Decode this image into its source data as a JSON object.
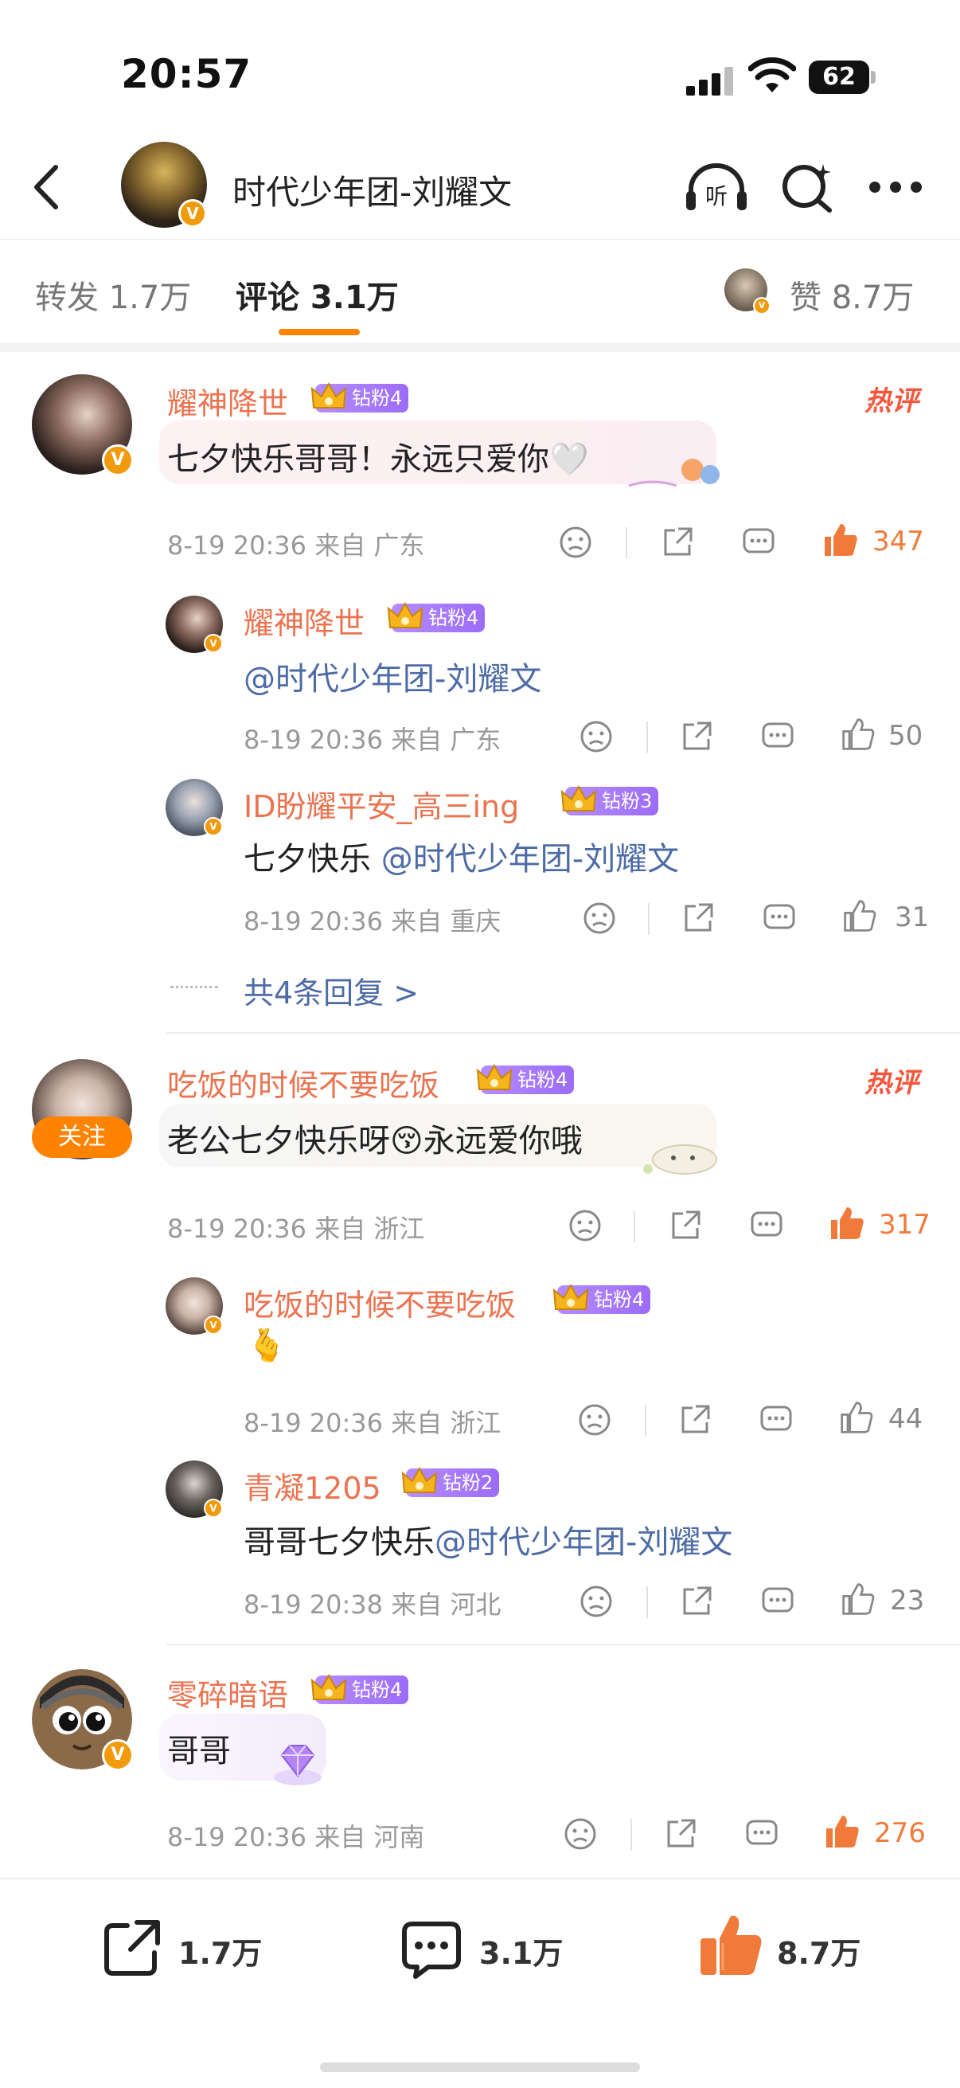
{
  "status_bar": {
    "time": "20:57",
    "battery": "62"
  },
  "header": {
    "title": "时代少年团-刘耀文",
    "listen_label": "听"
  },
  "tabs": {
    "repost": "转发 1.7万",
    "comments": "评论 3.1万",
    "likes": "赞 8.7万"
  },
  "comments": [
    {
      "user": "耀神降世",
      "badge": "钻粉4",
      "hot": "热评",
      "text": "七夕快乐哥哥！永远只爱你🤍",
      "meta": "8-19 20:36 来自 广东",
      "likes": "347",
      "replies": [
        {
          "user": "耀神降世",
          "badge": "钻粉4",
          "mention": "@时代少年团-刘耀文",
          "meta": "8-19 20:36 来自 广东",
          "likes": "50"
        },
        {
          "user": "ID盼耀平安_高三ing",
          "badge": "钻粉3",
          "text": "七夕快乐 ",
          "mention": "@时代少年团-刘耀文",
          "meta": "8-19 20:36 来自 重庆",
          "likes": "31"
        }
      ],
      "more_replies": "共4条回复 >"
    },
    {
      "user": "吃饭的时候不要吃饭",
      "badge": "钻粉4",
      "hot": "热评",
      "follow": "关注",
      "text": "老公七夕快乐呀😚永远爱你哦",
      "meta": "8-19 20:36 来自 浙江",
      "likes": "317",
      "replies": [
        {
          "user": "吃饭的时候不要吃饭",
          "badge": "钻粉4",
          "text": "🫰",
          "meta": "8-19 20:36 来自 浙江",
          "likes": "44"
        },
        {
          "user": "青凝1205",
          "badge": "钻粉2",
          "text": "哥哥七夕快乐",
          "mention": "@时代少年团-刘耀文",
          "meta": "8-19 20:38 来自 河北",
          "likes": "23"
        }
      ]
    },
    {
      "user": "零碎暗语",
      "badge": "钻粉4",
      "text": "哥哥",
      "meta": "8-19 20:36 来自 河南",
      "likes": "276"
    }
  ],
  "bottom_bar": {
    "repost": "1.7万",
    "comments": "3.1万",
    "likes": "8.7万"
  },
  "colors": {
    "accent": "#ff8200",
    "username": "#eb7350",
    "mention": "#4d6ba6",
    "hot": "#f5573c",
    "badge": "#a878fb"
  }
}
